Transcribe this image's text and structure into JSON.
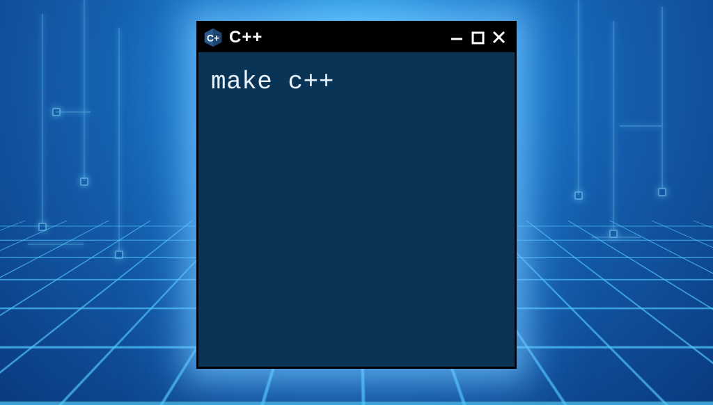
{
  "terminal": {
    "title": "C++",
    "content": "make c++",
    "logo_label": "cpp-logo"
  },
  "window_controls": {
    "minimize_label": "minimize",
    "maximize_label": "maximize",
    "close_label": "close"
  },
  "colors": {
    "titlebar_bg": "#000000",
    "terminal_bg": "#0a3456",
    "text": "#e8f0f8",
    "glow": "#78c8ff"
  }
}
